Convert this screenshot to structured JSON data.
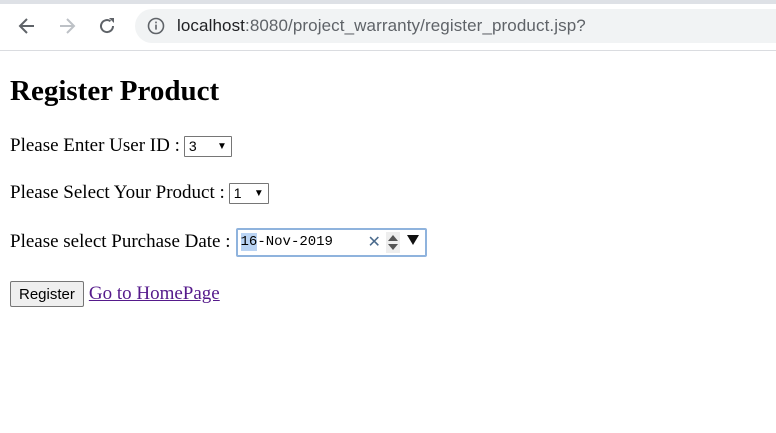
{
  "browser": {
    "url_host": "localhost",
    "url_rest": ":8080/project_warranty/register_product.jsp?"
  },
  "page": {
    "title": "Register Product",
    "user_id": {
      "label": "Please Enter User ID :",
      "selected": "3"
    },
    "product": {
      "label": "Please Select Your Product :",
      "selected": "1"
    },
    "purchase_date": {
      "label": "Please select Purchase Date :",
      "day": "16",
      "rest": "-Nov-2019"
    },
    "register_button": "Register",
    "home_link": "Go to HomePage"
  },
  "colors": {
    "link_visited": "#551a8b",
    "focus_border": "#8fb3dd",
    "selection_highlight": "#b9d3f3"
  }
}
